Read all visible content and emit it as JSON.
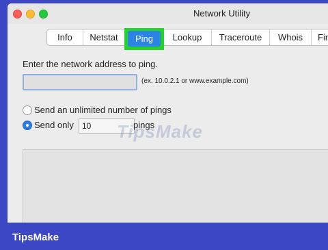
{
  "window": {
    "title": "Network Utility"
  },
  "tabs": [
    {
      "label": "Info"
    },
    {
      "label": "Netstat"
    },
    {
      "label": "Ping",
      "selected": true
    },
    {
      "label": "Lookup"
    },
    {
      "label": "Traceroute"
    },
    {
      "label": "Whois"
    },
    {
      "label": "Fin"
    }
  ],
  "ping": {
    "prompt": "Enter the network address to ping.",
    "address_value": "",
    "address_hint": "(ex. 10.0.2.1 or www.example.com)",
    "option_unlimited": "Send an unlimited number of pings",
    "option_send_only": "Send only",
    "count_value": "10",
    "count_suffix": "pings"
  },
  "watermark": "TipsMake",
  "brand": "TipsMake",
  "colors": {
    "frame": "#3b47c4",
    "highlight": "#24d32b",
    "selected_tab": "#2c83e6"
  }
}
